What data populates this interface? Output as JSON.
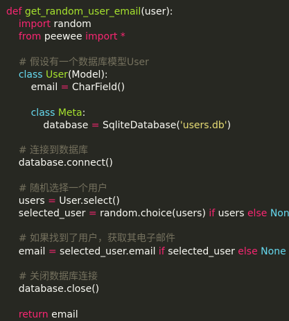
{
  "theme": {
    "background": "#272822",
    "keyword": "#f92672",
    "function": "#a6e22e",
    "class_name": "#66d9ef",
    "comment": "#75715e",
    "string": "#e6db74",
    "text": "#f8f8f2"
  },
  "code": {
    "lines": [
      [
        {
          "t": "def ",
          "c": "kw"
        },
        {
          "t": "get_random_user_email",
          "c": "fn"
        },
        {
          "t": "(user):",
          "c": "plain"
        }
      ],
      [
        {
          "t": "    ",
          "c": "plain"
        },
        {
          "t": "import",
          "c": "kw"
        },
        {
          "t": " random",
          "c": "plain"
        }
      ],
      [
        {
          "t": "    ",
          "c": "plain"
        },
        {
          "t": "from",
          "c": "kw"
        },
        {
          "t": " peewee ",
          "c": "plain"
        },
        {
          "t": "import",
          "c": "kw"
        },
        {
          "t": " *",
          "c": "op"
        }
      ],
      [
        {
          "t": "",
          "c": "plain"
        }
      ],
      [
        {
          "t": "    ",
          "c": "plain"
        },
        {
          "t": "# 假设有一个数据库模型User",
          "c": "cm"
        }
      ],
      [
        {
          "t": "    ",
          "c": "plain"
        },
        {
          "t": "class ",
          "c": "cls"
        },
        {
          "t": "User",
          "c": "fn"
        },
        {
          "t": "(Model):",
          "c": "plain"
        }
      ],
      [
        {
          "t": "        email ",
          "c": "plain"
        },
        {
          "t": "=",
          "c": "op"
        },
        {
          "t": " CharField()",
          "c": "plain"
        }
      ],
      [
        {
          "t": "",
          "c": "plain"
        }
      ],
      [
        {
          "t": "        ",
          "c": "plain"
        },
        {
          "t": "class ",
          "c": "cls"
        },
        {
          "t": "Meta",
          "c": "fn"
        },
        {
          "t": ":",
          "c": "plain"
        }
      ],
      [
        {
          "t": "            database ",
          "c": "plain"
        },
        {
          "t": "=",
          "c": "op"
        },
        {
          "t": " SqliteDatabase(",
          "c": "plain"
        },
        {
          "t": "'users.db'",
          "c": "str"
        },
        {
          "t": ")",
          "c": "plain"
        }
      ],
      [
        {
          "t": "",
          "c": "plain"
        }
      ],
      [
        {
          "t": "    ",
          "c": "plain"
        },
        {
          "t": "# 连接到数据库",
          "c": "cm"
        }
      ],
      [
        {
          "t": "    database.connect()",
          "c": "plain"
        }
      ],
      [
        {
          "t": "",
          "c": "plain"
        }
      ],
      [
        {
          "t": "    ",
          "c": "plain"
        },
        {
          "t": "# 随机选择一个用户",
          "c": "cm"
        }
      ],
      [
        {
          "t": "    users ",
          "c": "plain"
        },
        {
          "t": "=",
          "c": "op"
        },
        {
          "t": " User.select()",
          "c": "plain"
        }
      ],
      [
        {
          "t": "    selected_user ",
          "c": "plain"
        },
        {
          "t": "=",
          "c": "op"
        },
        {
          "t": " random.choice(users) ",
          "c": "plain"
        },
        {
          "t": "if",
          "c": "kw"
        },
        {
          "t": " users ",
          "c": "plain"
        },
        {
          "t": "else",
          "c": "kw"
        },
        {
          "t": " ",
          "c": "plain"
        },
        {
          "t": "None",
          "c": "const"
        }
      ],
      [
        {
          "t": "",
          "c": "plain"
        }
      ],
      [
        {
          "t": "    ",
          "c": "plain"
        },
        {
          "t": "# 如果找到了用户，获取其电子邮件",
          "c": "cm"
        }
      ],
      [
        {
          "t": "    email ",
          "c": "plain"
        },
        {
          "t": "=",
          "c": "op"
        },
        {
          "t": " selected_user.email ",
          "c": "plain"
        },
        {
          "t": "if",
          "c": "kw"
        },
        {
          "t": " selected_user ",
          "c": "plain"
        },
        {
          "t": "else",
          "c": "kw"
        },
        {
          "t": " ",
          "c": "plain"
        },
        {
          "t": "None",
          "c": "const"
        }
      ],
      [
        {
          "t": "",
          "c": "plain"
        }
      ],
      [
        {
          "t": "    ",
          "c": "plain"
        },
        {
          "t": "# 关闭数据库连接",
          "c": "cm"
        }
      ],
      [
        {
          "t": "    database.close()",
          "c": "plain"
        }
      ],
      [
        {
          "t": "",
          "c": "plain"
        }
      ],
      [
        {
          "t": "    ",
          "c": "plain"
        },
        {
          "t": "return",
          "c": "kw"
        },
        {
          "t": " email",
          "c": "plain"
        }
      ]
    ]
  }
}
